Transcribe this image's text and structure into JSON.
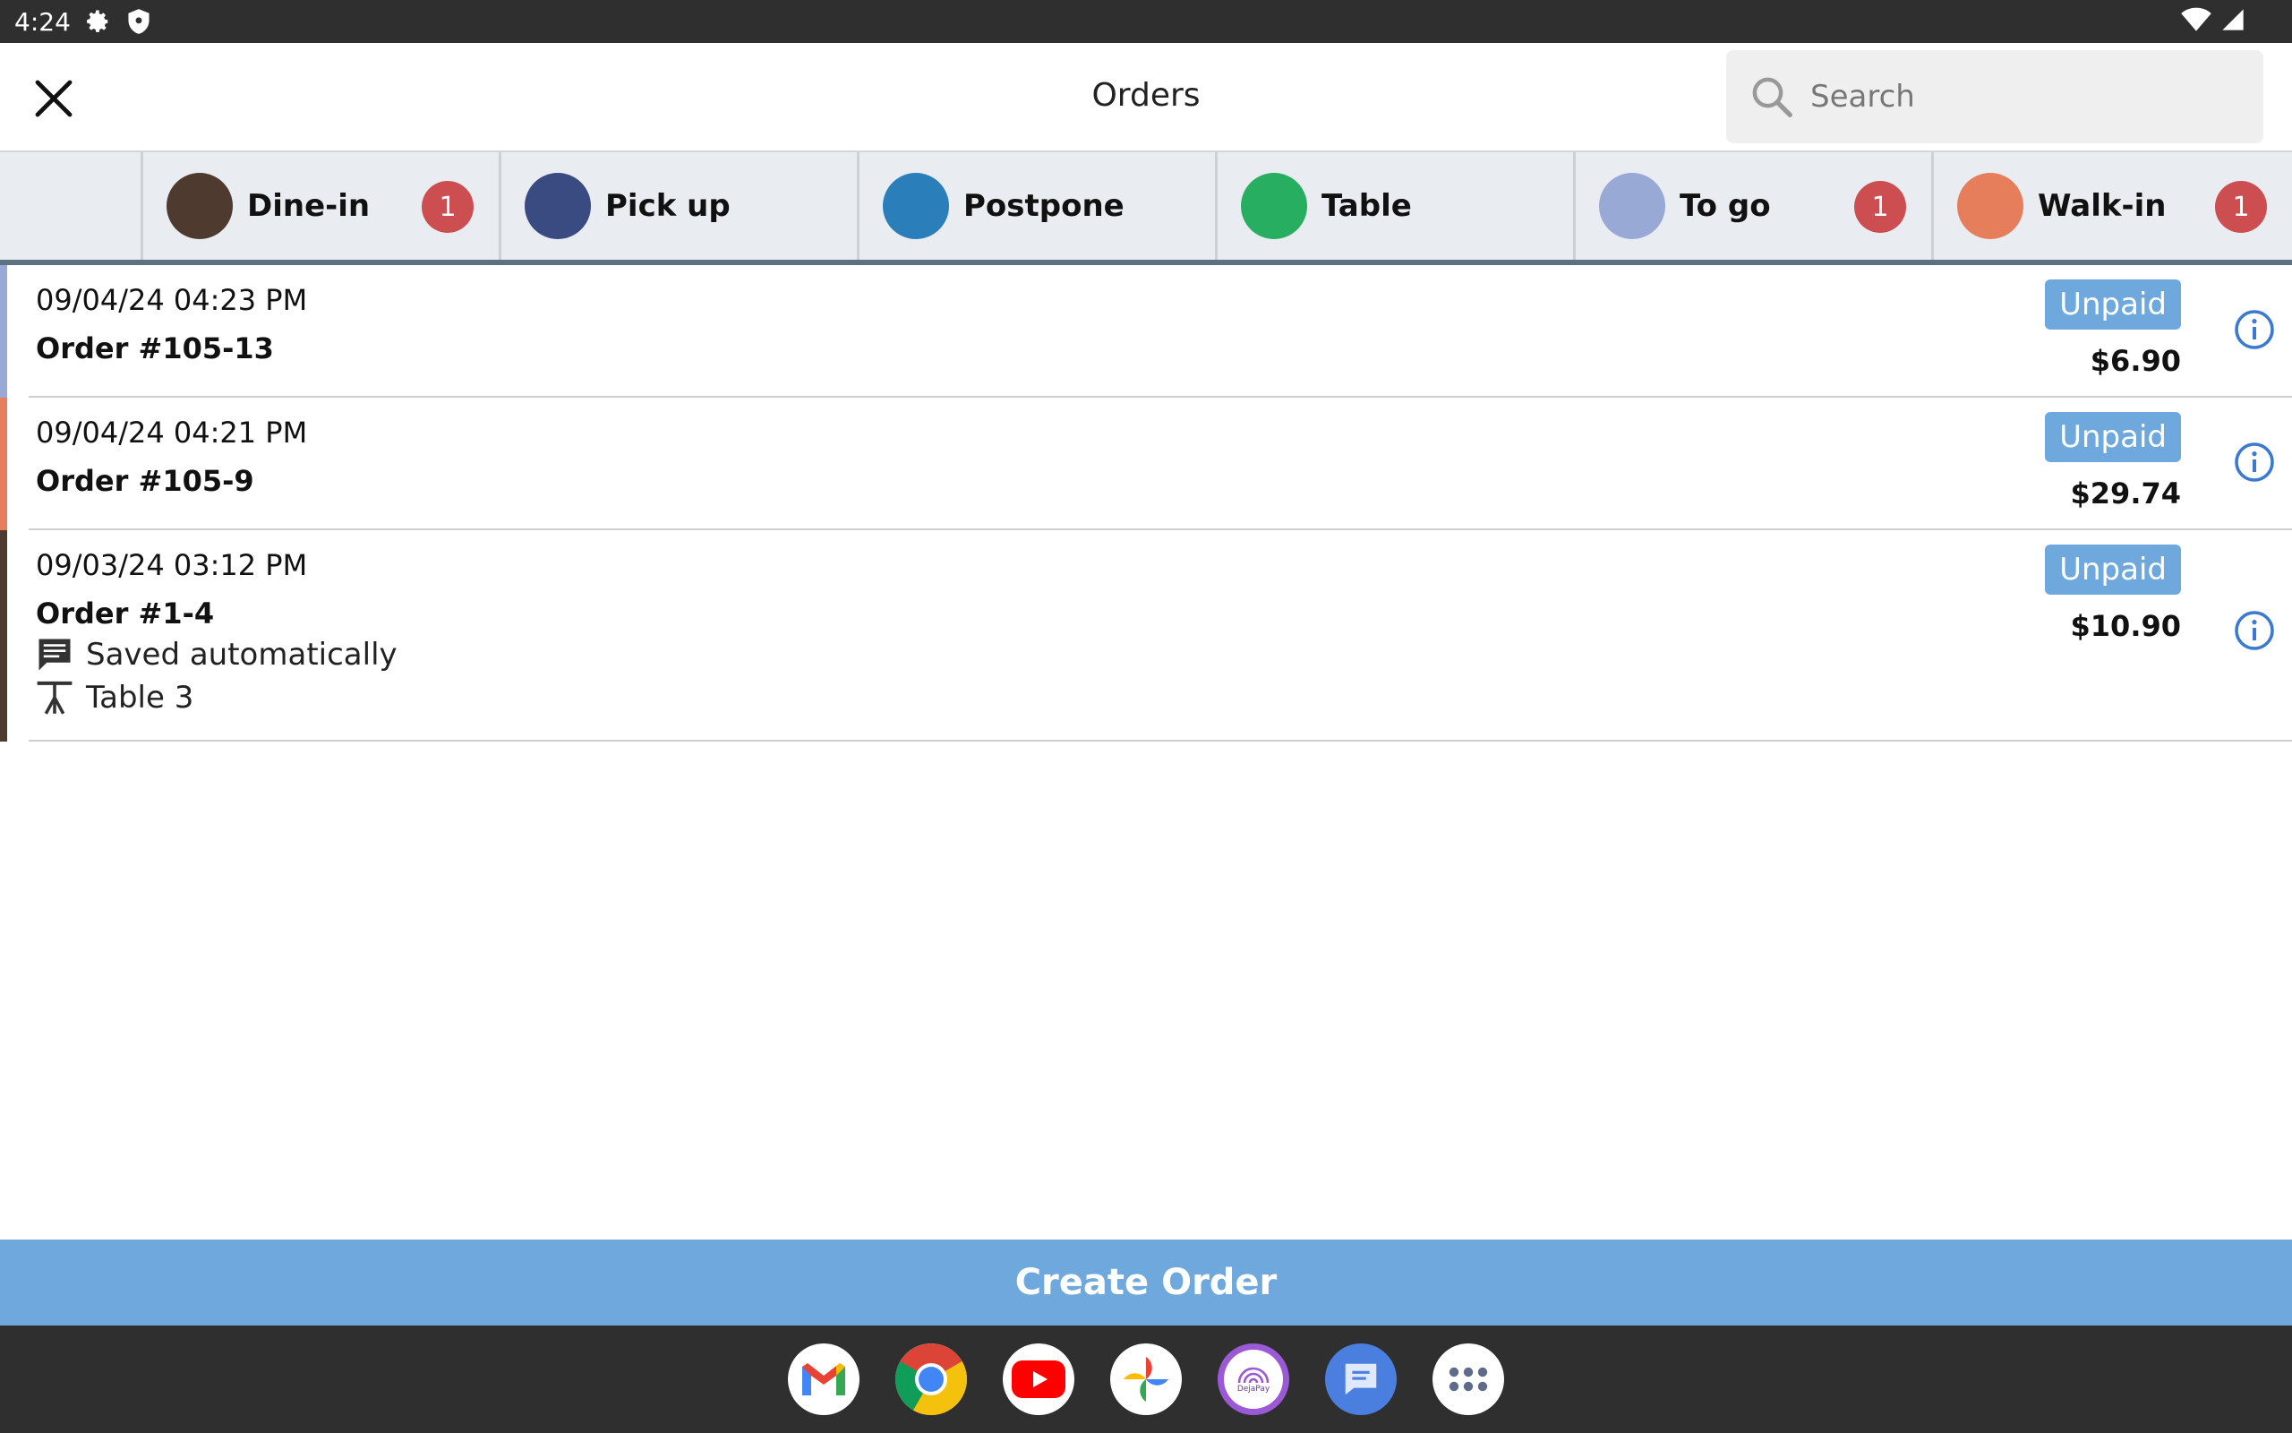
{
  "status_bar": {
    "time": "4:24",
    "icons": [
      "gear-icon",
      "shield-icon",
      "wifi-icon",
      "signal-icon"
    ]
  },
  "header": {
    "title": "Orders",
    "close_icon": "close-icon",
    "search": {
      "placeholder": "Search",
      "value": ""
    }
  },
  "categories": [
    {
      "label": "Dine-in",
      "color": "#4e3a2f",
      "count": "1"
    },
    {
      "label": "Pick up",
      "color": "#3a4b82",
      "count": ""
    },
    {
      "label": "Postpone",
      "color": "#2a7fba",
      "count": ""
    },
    {
      "label": "Table",
      "color": "#27ae60",
      "count": ""
    },
    {
      "label": "To go",
      "color": "#98a9d6",
      "count": "1"
    },
    {
      "label": "Walk-in",
      "color": "#e67e5b",
      "count": "1"
    }
  ],
  "orders": [
    {
      "datetime": "09/04/24 04:23 PM",
      "number": "Order #105-13",
      "status": "Unpaid",
      "total": "$6.90",
      "stripe_color": "#98a9d6"
    },
    {
      "datetime": "09/04/24 04:21 PM",
      "number": "Order #105-9",
      "status": "Unpaid",
      "total": "$29.74",
      "stripe_color": "#e67e5b"
    },
    {
      "datetime": "09/03/24 03:12 PM",
      "number": "Order #1-4",
      "status": "Unpaid",
      "total": "$10.90",
      "stripe_color": "#4e3a2f",
      "note": "Saved automatically",
      "table": "Table 3"
    }
  ],
  "create_button": "Create Order",
  "dock": {
    "apps": [
      "gmail-icon",
      "chrome-icon",
      "youtube-icon",
      "photos-icon",
      "depay-icon",
      "messages-icon",
      "app-drawer-icon"
    ],
    "depay_label": "DejaPay"
  },
  "colors": {
    "accent": "#6fa8dc",
    "badge": "#cc4e51",
    "underline": "#5e7180"
  }
}
